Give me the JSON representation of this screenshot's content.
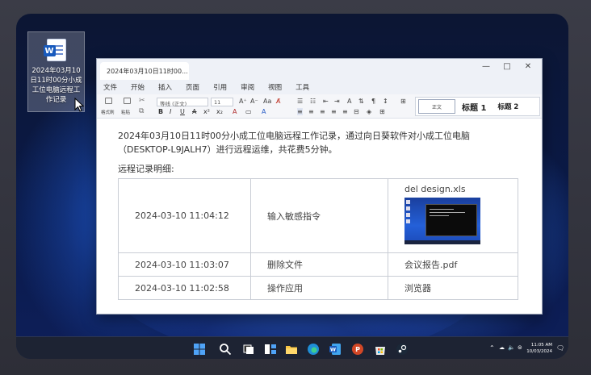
{
  "desktop_icon": {
    "label": "2024年03月10日11时00分小成工位电脑远程工作记录"
  },
  "window": {
    "tab_title": "2024年03月10日11时00...",
    "controls": {
      "minimize": "—",
      "maximize": "□",
      "close": "✕"
    }
  },
  "menu": [
    "文件",
    "开始",
    "插入",
    "页面",
    "引用",
    "审阅",
    "视图",
    "工具"
  ],
  "ribbon": {
    "format_painter": "格式刷",
    "paste": "粘贴",
    "font_name": "等线 (正文)",
    "font_size": "11",
    "styles": {
      "normal": "正文",
      "heading1": "标题 1",
      "heading2": "标题 2"
    }
  },
  "document": {
    "intro": "2024年03月10日11时00分小成工位电脑远程工作记录，通过向日葵软件对小成工位电脑（DESKTOP-L9JALH7）进行远程运维，共花费5分钟。",
    "subtitle": "远程记录明细:",
    "rows": [
      {
        "time": "2024-03-10 11:04:12",
        "action": "输入敏感指令",
        "detail": "del design.xls"
      },
      {
        "time": "2024-03-10 11:03:07",
        "action": "删除文件",
        "detail": "会议报告.pdf"
      },
      {
        "time": "2024-03-10 11:02:58",
        "action": "操作应用",
        "detail": "浏览器"
      }
    ]
  },
  "taskbar": {
    "time": "11:05 AM",
    "date": "10/03/2024",
    "icons": [
      "start-icon",
      "search-icon",
      "task-view-icon",
      "widgets-icon",
      "file-explorer-icon",
      "edge-icon",
      "word-icon",
      "powerpoint-icon",
      "store-icon",
      "steam-icon"
    ]
  },
  "colors": {
    "word_blue": "#185abd",
    "taskbar": "#1d2333",
    "accent": "#2b66d8"
  }
}
